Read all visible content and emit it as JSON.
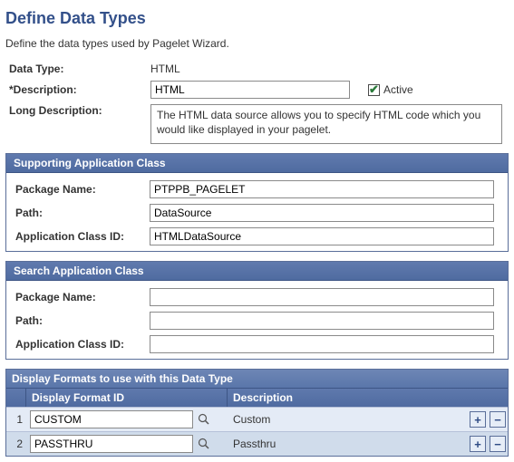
{
  "page": {
    "title": "Define Data Types",
    "subtitle": "Define the data types used by Pagelet Wizard."
  },
  "fields": {
    "dataTypeLabel": "Data Type:",
    "dataTypeValue": "HTML",
    "descriptionLabel": "*Description:",
    "descriptionValue": "HTML",
    "activeLabel": "Active",
    "activeChecked": true,
    "longDescriptionLabel": "Long Description:",
    "longDescriptionValue": "The HTML data source allows you to specify HTML code which you would like displayed in your pagelet."
  },
  "supporting": {
    "header": "Supporting Application Class",
    "packageLabel": "Package Name:",
    "packageValue": "PTPPB_PAGELET",
    "pathLabel": "Path:",
    "pathValue": "DataSource",
    "classLabel": "Application Class ID:",
    "classValue": "HTMLDataSource"
  },
  "search": {
    "header": "Search Application Class",
    "packageLabel": "Package Name:",
    "packageValue": "",
    "pathLabel": "Path:",
    "pathValue": "",
    "classLabel": "Application Class ID:",
    "classValue": ""
  },
  "grid": {
    "title": "Display Formats to use with this Data Type",
    "colId": "Display Format ID",
    "colDesc": "Description",
    "rows": [
      {
        "num": "1",
        "id": "CUSTOM",
        "desc": "Custom"
      },
      {
        "num": "2",
        "id": "PASSTHRU",
        "desc": "Passthru"
      }
    ],
    "addLabel": "+",
    "removeLabel": "−"
  }
}
